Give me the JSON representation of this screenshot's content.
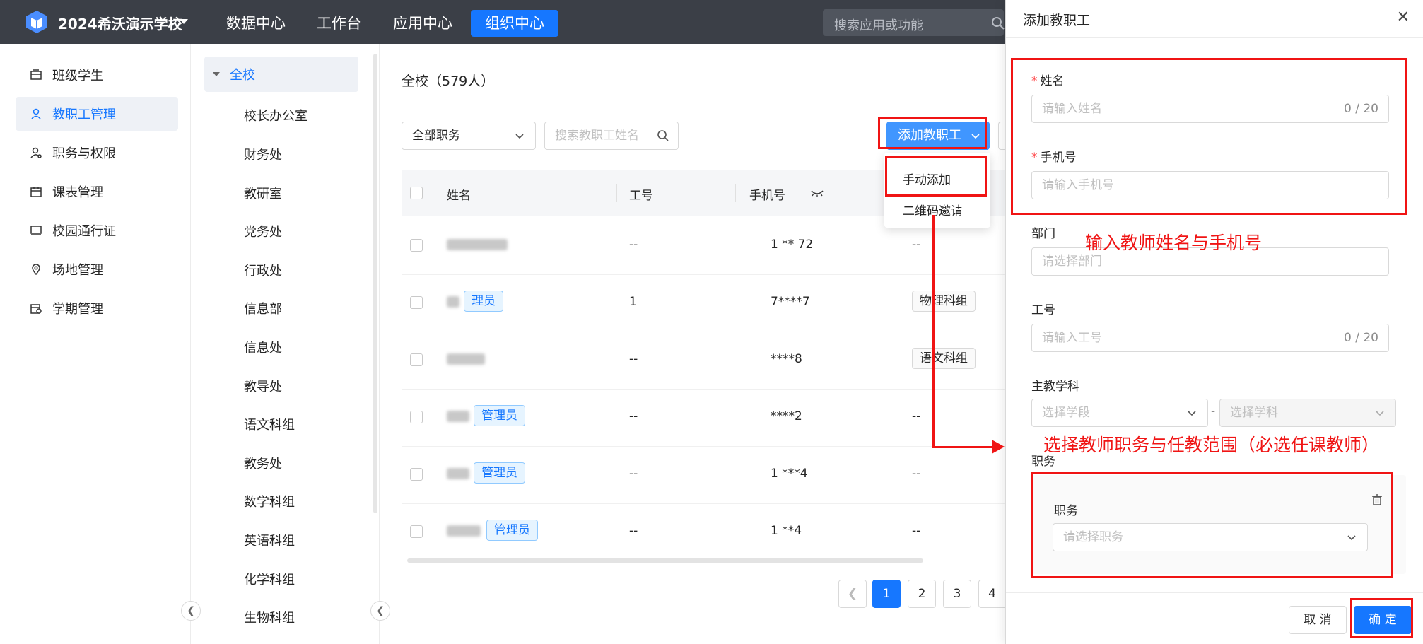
{
  "header": {
    "school_name": "2024希沃演示学校",
    "nav": [
      "数据中心",
      "工作台",
      "应用中心",
      "组织中心"
    ],
    "active_nav": "组织中心",
    "search_placeholder": "搜索应用或功能"
  },
  "sidebar": {
    "items": [
      {
        "label": "班级学生",
        "icon": "class-icon"
      },
      {
        "label": "教职工管理",
        "icon": "user-icon",
        "active": true
      },
      {
        "label": "职务与权限",
        "icon": "role-icon"
      },
      {
        "label": "课表管理",
        "icon": "calendar-icon"
      },
      {
        "label": "校园通行证",
        "icon": "card-icon"
      },
      {
        "label": "场地管理",
        "icon": "location-icon"
      },
      {
        "label": "学期管理",
        "icon": "term-icon"
      }
    ]
  },
  "org_tree": {
    "root": "全校",
    "nodes": [
      "校长办公室",
      "财务处",
      "教研室",
      "党务处",
      "行政处",
      "信息部",
      "信息处",
      "教导处",
      "语文科组",
      "教务处",
      "数学科组",
      "英语科组",
      "化学科组",
      "生物科组"
    ]
  },
  "main": {
    "title": "全校（579人）",
    "filter_select": "全部职务",
    "search_placeholder": "搜索教职工姓名",
    "add_button": "添加教职工",
    "dropdown": [
      "手动添加",
      "二维码邀请"
    ],
    "columns": [
      "姓名",
      "工号",
      "手机号"
    ],
    "rows": [
      {
        "name_prefix": "",
        "tag": "",
        "job_no": "--",
        "phone": "1 ** 72",
        "group": "--"
      },
      {
        "name_prefix": "",
        "tag": "理员",
        "job_no": "1",
        "phone": "7****7",
        "group": "物理科组"
      },
      {
        "name_prefix": "",
        "tag": "",
        "job_no": "--",
        "phone": "****8",
        "group": "语文科组"
      },
      {
        "name_prefix": "",
        "tag": "管理员",
        "job_no": "--",
        "phone": "****2",
        "group": "--"
      },
      {
        "name_prefix": "",
        "tag": "管理员",
        "job_no": "--",
        "phone": "1 ***4",
        "group": "--"
      },
      {
        "name_prefix": "",
        "tag": "管理员",
        "job_no": "--",
        "phone": "1 **4",
        "group": "--"
      }
    ],
    "pages": [
      "1",
      "2",
      "3",
      "4"
    ],
    "prev_icon": "chevron-left-icon"
  },
  "drawer": {
    "title": "添加教职工",
    "name_label": "姓名",
    "name_placeholder": "请输入姓名",
    "name_count": "0 / 20",
    "phone_label": "手机号",
    "phone_placeholder": "请输入手机号",
    "dept_label": "部门",
    "dept_placeholder": "请选择部门",
    "jobno_label": "工号",
    "jobno_placeholder": "请输入工号",
    "jobno_count": "0 / 20",
    "subject_label": "主教学科",
    "stage_placeholder": "选择学段",
    "subject_placeholder": "选择学科",
    "subject_sep": "-",
    "position_section": "职务",
    "position_label": "职务",
    "position_placeholder": "请选择职务",
    "cancel": "取 消",
    "ok": "确 定"
  },
  "annotations": {
    "note1": "输入教师姓名与手机号",
    "note2": "选择教师职务与任教范围（必选任课教师）",
    "color": "#f01414"
  }
}
